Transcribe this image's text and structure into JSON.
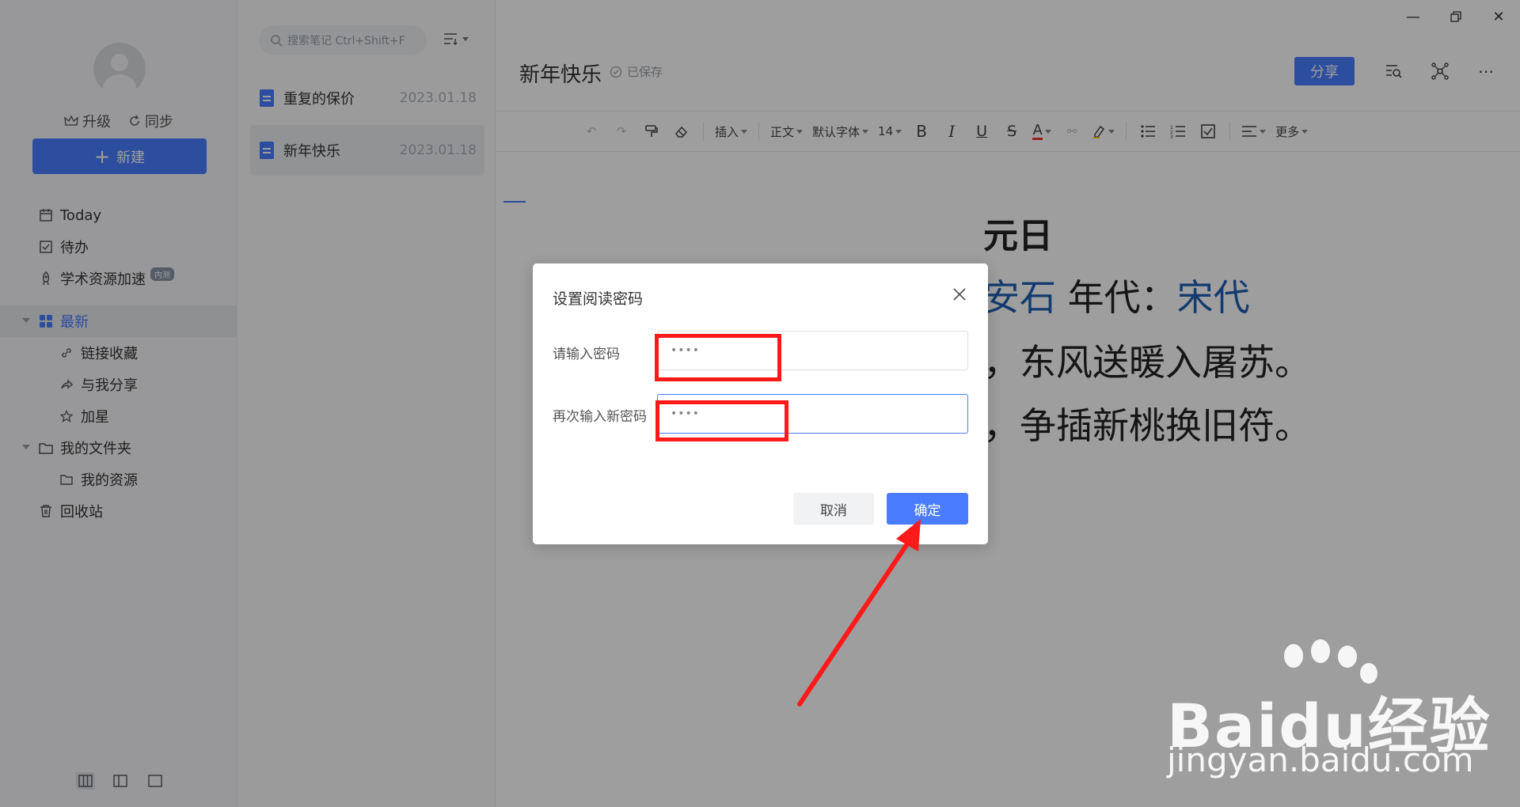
{
  "sidebar": {
    "upgrade_label": "升级",
    "sync_label": "同步",
    "new_label": "新建",
    "items": [
      {
        "label": "Today"
      },
      {
        "label": "待办"
      },
      {
        "label": "学术资源加速",
        "badge": "内测"
      },
      {
        "label": "最新"
      },
      {
        "label": "链接收藏"
      },
      {
        "label": "与我分享"
      },
      {
        "label": "加星"
      },
      {
        "label": "我的文件夹"
      },
      {
        "label": "我的资源"
      },
      {
        "label": "回收站"
      }
    ]
  },
  "notelist": {
    "search_placeholder": "搜索笔记 Ctrl+Shift+F",
    "notes": [
      {
        "title": "重复的保价",
        "date": "2023.01.18"
      },
      {
        "title": "新年快乐",
        "date": "2023.01.18"
      }
    ]
  },
  "editor": {
    "title": "新年快乐",
    "saved_label": "已保存",
    "share_label": "分享",
    "toolbar": {
      "insert": "插入",
      "style": "正文",
      "font": "默认字体",
      "size": "14",
      "more": "更多"
    },
    "content": {
      "heading": "元日",
      "line2_a": "安石",
      "line2_b": " 年代：",
      "line2_c": "宋代",
      "line3": "，东风送暖入屠苏。",
      "line4": "，争插新桃换旧符。"
    }
  },
  "dialog": {
    "title": "设置阅读密码",
    "label_password": "请输入密码",
    "label_confirm": "再次输入新密码",
    "password_value": "••••",
    "confirm_value": "••••",
    "cancel_label": "取消",
    "ok_label": "确定"
  },
  "watermark": {
    "brand": "Baidu经验",
    "url": "jingyan.baidu.com"
  },
  "colors": {
    "accent": "#4a7cff",
    "annotation_red": "#ff1a1a",
    "poem_blue": "#1f5fb4"
  }
}
